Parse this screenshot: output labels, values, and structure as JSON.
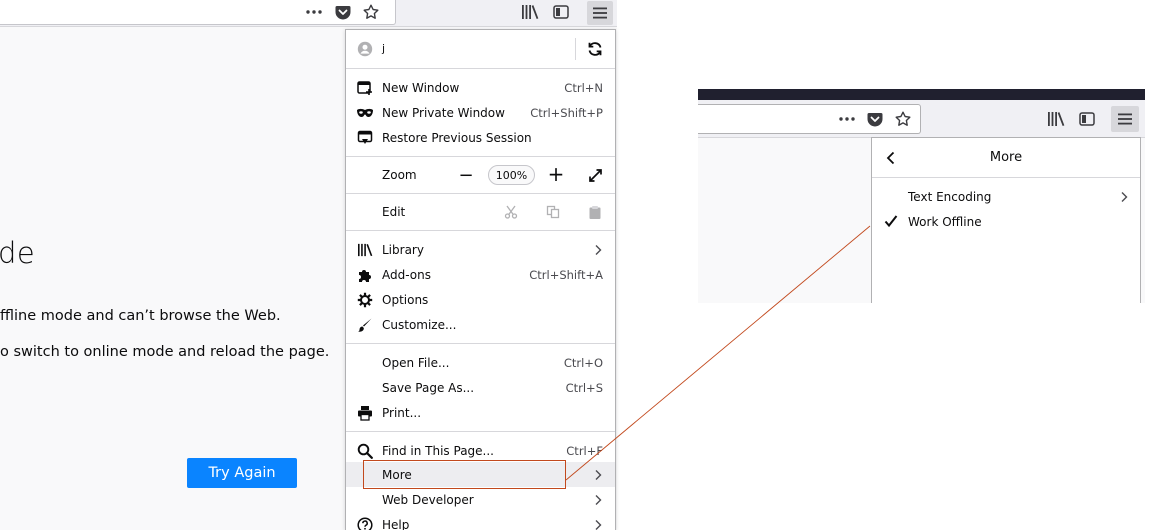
{
  "colors": {
    "accent": "#0a84ff",
    "highlight_outline": "#c2491d",
    "menu_highlight": "#ededf0",
    "inset_topbar": "#20202f"
  },
  "page": {
    "heading_fragment": "de",
    "line1": "ffline mode and can’t browse the Web.",
    "line2": "o switch to online mode and reload the page.",
    "try_again_label": "Try Again"
  },
  "toolbar": {
    "icons": [
      "more-dots-icon",
      "pocket-icon",
      "bookmark-star-icon",
      "library-icon",
      "sidebar-icon",
      "hamburger-menu-icon"
    ]
  },
  "menu": {
    "account_label": "j                      ",
    "new_window": {
      "label": "New Window",
      "shortcut": "Ctrl+N"
    },
    "new_private_window": {
      "label": "New Private Window",
      "shortcut": "Ctrl+Shift+P"
    },
    "restore_session": {
      "label": "Restore Previous Session"
    },
    "zoom": {
      "label": "Zoom",
      "minus": "−",
      "level": "100%",
      "plus": "+"
    },
    "edit": {
      "label": "Edit"
    },
    "library": {
      "label": "Library"
    },
    "addons": {
      "label": "Add-ons",
      "shortcut": "Ctrl+Shift+A"
    },
    "options": {
      "label": "Options"
    },
    "customize": {
      "label": "Customize..."
    },
    "open_file": {
      "label": "Open File...",
      "shortcut": "Ctrl+O"
    },
    "save_page": {
      "label": "Save Page As...",
      "shortcut": "Ctrl+S"
    },
    "print": {
      "label": "Print..."
    },
    "find": {
      "label": "Find in This Page...",
      "shortcut": "Ctrl+F"
    },
    "more": {
      "label": "More"
    },
    "web_developer": {
      "label": "Web Developer"
    },
    "help": {
      "label": "Help"
    }
  },
  "submenu": {
    "title": "More",
    "text_encoding": "Text Encoding",
    "work_offline": "Work Offline",
    "work_offline_checked": true
  }
}
